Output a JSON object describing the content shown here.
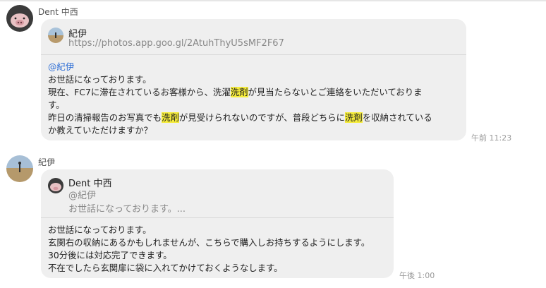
{
  "messages": [
    {
      "sender": "Dent 中西",
      "quote": {
        "author": "紀伊",
        "link": "https://photos.app.goo.gl/2AtuhThyU5sMF2F67"
      },
      "mention": "@紀伊",
      "body": {
        "line1": "お世話になっております。",
        "line2_a": "現在、FC7に滞在されているお客様から、洗濯",
        "line2_hl": "洗剤",
        "line2_b": "が見当たらないとご連絡をいただいておりま",
        "line3": "す。",
        "line4_a": "昨日の清掃報告のお写真でも",
        "line4_hl": "洗剤",
        "line4_b": "が見受けられないのですが、普段どちらに",
        "line4_hl2": "洗剤",
        "line4_c": "を収納されている",
        "line5": "か教えていただけますか？"
      },
      "time": "午前 11:23"
    },
    {
      "sender": "紀伊",
      "quote": {
        "author": "Dent 中西",
        "mention": "@紀伊",
        "snippet": "お世話になっております。..."
      },
      "body": {
        "line1": "お世話になっております。",
        "line2": "玄関右の収納にあるかもしれませんが、こちらで購入しお持ちするようにします。",
        "line3": "30分後には対応完了できます。",
        "line4": "不在でしたら玄関扉に袋に入れてかけておくようなします。"
      },
      "time": "午後 1:00"
    }
  ],
  "colors": {
    "highlight": "#f5ec3b",
    "mention": "#2f6fd6",
    "bubble": "#efefef"
  }
}
